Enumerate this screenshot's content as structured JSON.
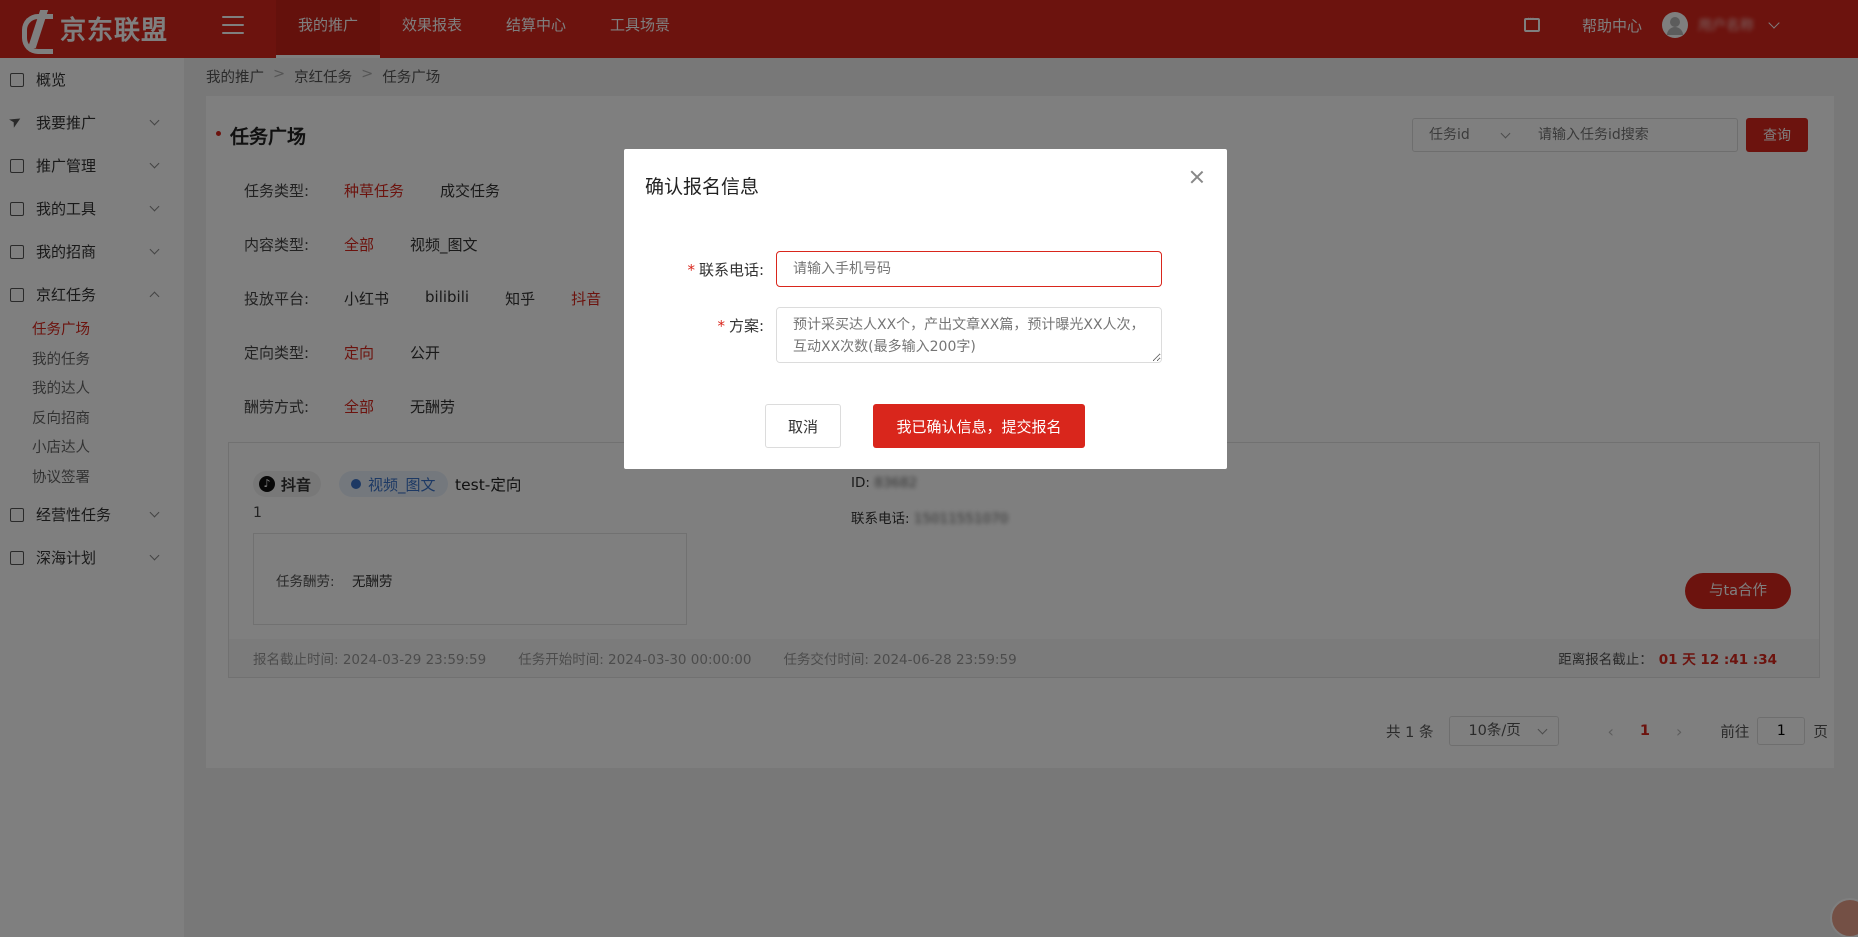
{
  "header": {
    "logo_text": "京东联盟",
    "nav": [
      "我的推广",
      "效果报表",
      "结算中心",
      "工具场景"
    ],
    "help": "帮助中心",
    "username": "用户名称"
  },
  "sidebar": {
    "items": [
      {
        "label": "概览",
        "icon": "dashboard-icon"
      },
      {
        "label": "我要推广",
        "icon": "send-icon"
      },
      {
        "label": "推广管理",
        "icon": "manage-icon"
      },
      {
        "label": "我的工具",
        "icon": "tools-icon"
      },
      {
        "label": "我的招商",
        "icon": "merchant-icon"
      },
      {
        "label": "京红任务",
        "icon": "task-icon"
      }
    ],
    "sub_items": [
      "任务广场",
      "我的任务",
      "我的达人",
      "反向招商",
      "小店达人",
      "协议签署"
    ],
    "items_after": [
      {
        "label": "经营性任务",
        "icon": "business-icon"
      },
      {
        "label": "深海计划",
        "icon": "deepsea-icon"
      }
    ]
  },
  "breadcrumb": [
    "我的推广",
    "京红任务",
    "任务广场"
  ],
  "page": {
    "title": "任务广场",
    "search_select": "任务id",
    "search_placeholder": "请输入任务id搜索",
    "search_button": "查询"
  },
  "filters": [
    {
      "label": "任务类型:",
      "options": [
        "种草任务",
        "成交任务"
      ],
      "active": 0
    },
    {
      "label": "内容类型:",
      "options": [
        "全部",
        "视频_图文"
      ],
      "active": 0
    },
    {
      "label": "投放平台:",
      "options": [
        "小红书",
        "bilibili",
        "知乎",
        "抖音"
      ],
      "active": 3
    },
    {
      "label": "定向类型:",
      "options": [
        "定向",
        "公开"
      ],
      "active": 0
    },
    {
      "label": "酬劳方式:",
      "options": [
        "全部",
        "无酬劳"
      ],
      "active": 0
    }
  ],
  "task": {
    "platform": "抖音",
    "content_type": "视频_图文",
    "name": "test-定向",
    "number": "1",
    "reward_label": "任务酬劳:",
    "reward_value": "无酬劳",
    "id_label": "ID:",
    "id_value": "83682",
    "phone_label": "联系电话:",
    "phone_value": "15011551070",
    "coop_button": "与ta合作",
    "signup_deadline": "报名截止时间: 2024-03-29 23:59:59",
    "start_time": "任务开始时间: 2024-03-30 00:00:00",
    "delivery_time": "任务交付时间: 2024-06-28 23:59:59",
    "countdown_label": "距离报名截止：",
    "countdown_value": "01 天 12 :41 :34"
  },
  "pagination": {
    "total": "共 1 条",
    "page_size": "10条/页",
    "current": "1",
    "goto_label": "前往",
    "goto_value": "1",
    "page_suffix": "页"
  },
  "modal": {
    "title": "确认报名信息",
    "phone_label": "联系电话:",
    "phone_placeholder": "请输入手机号码",
    "plan_label": "方案:",
    "plan_placeholder": "预计采买达人XX个，产出文章XX篇，预计曝光XX人次，互动XX次数(最多输入200字)",
    "cancel": "取消",
    "submit": "我已确认信息，提交报名"
  }
}
